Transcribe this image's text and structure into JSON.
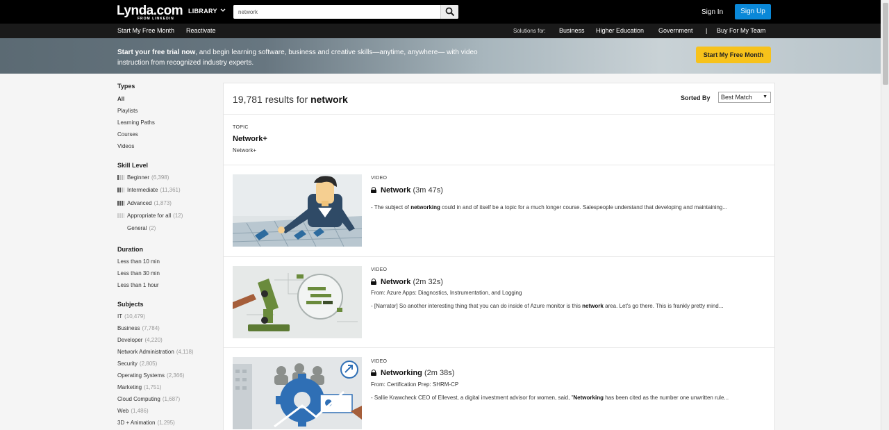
{
  "header": {
    "logo": "Lynda.com",
    "logo_sub": "FROM LINKEDIN",
    "library_label": "LIBRARY",
    "search_value": "network",
    "signin_label": "Sign In",
    "signup_label": "Sign Up"
  },
  "subnav": {
    "left": [
      "Start My Free Month",
      "Reactivate"
    ],
    "solutions_label": "Solutions for:",
    "right": [
      "Business",
      "Higher Education",
      "Government",
      "|",
      "Buy For My Team"
    ]
  },
  "banner": {
    "bold": "Start your free trial now",
    "text": ", and begin learning software, business and creative skills—anytime, anywhere— with video instruction from recognized industry experts.",
    "cta": "Start My Free Month"
  },
  "sidebar": {
    "types": {
      "heading": "Types",
      "items": [
        "All",
        "Playlists",
        "Learning Paths",
        "Courses",
        "Videos"
      ]
    },
    "skill": {
      "heading": "Skill Level",
      "items": [
        {
          "label": "Beginner",
          "count": "(6,398)"
        },
        {
          "label": "Intermediate",
          "count": "(11,361)"
        },
        {
          "label": "Advanced",
          "count": "(1,873)"
        },
        {
          "label": "Appropriate for all",
          "count": "(12)"
        },
        {
          "label": "General",
          "count": "(2)"
        }
      ]
    },
    "duration": {
      "heading": "Duration",
      "items": [
        "Less than 10 min",
        "Less than 30 min",
        "Less than 1 hour"
      ]
    },
    "subjects": {
      "heading": "Subjects",
      "items": [
        {
          "label": "IT",
          "count": "(10,479)"
        },
        {
          "label": "Business",
          "count": "(7,784)"
        },
        {
          "label": "Developer",
          "count": "(4,220)"
        },
        {
          "label": "Network Administration",
          "count": "(4,118)"
        },
        {
          "label": "Security",
          "count": "(2,805)"
        },
        {
          "label": "Operating Systems",
          "count": "(2,366)"
        },
        {
          "label": "Marketing",
          "count": "(1,751)"
        },
        {
          "label": "Cloud Computing",
          "count": "(1,687)"
        },
        {
          "label": "Web",
          "count": "(1,486)"
        },
        {
          "label": "3D + Animation",
          "count": "(1,295)"
        }
      ]
    }
  },
  "results": {
    "count": "19,781",
    "text": "results for",
    "query": "network",
    "sorted_label": "Sorted By",
    "sort_value": "Best Match",
    "topic": {
      "label": "TOPIC",
      "title": "Network+",
      "sub": "Network+"
    },
    "videos": [
      {
        "label": "VIDEO",
        "title": "Network",
        "duration": "(3m 47s)",
        "from": "",
        "desc_pre": "- The subject of ",
        "desc_bold": "networking",
        "desc_post": " could in and of itself be a topic for a much longer course. Salespeople understand that developing and maintaining..."
      },
      {
        "label": "VIDEO",
        "title": "Network",
        "duration": "(2m 32s)",
        "from": "From: Azure Apps: Diagnostics, Instrumentation, and Logging",
        "desc_pre": "- [Narrator] So another interesting thing that you can do inside of Azure monitor is this ",
        "desc_bold": "network",
        "desc_post": " area. Let's go there. This is frankly pretty mind..."
      },
      {
        "label": "VIDEO",
        "title": "Networking",
        "duration": "(2m 38s)",
        "from": "From: Certification Prep: SHRM-CP",
        "desc_pre": "- Sallie Krawcheck CEO of Ellevest, a digital investment advisor for women, said, \"",
        "desc_bold": "Networking",
        "desc_post": " has been cited as the number one unwritten rule..."
      }
    ]
  },
  "colors": {
    "accent_blue": "#0a88d8",
    "cta_yellow": "#f7c21b",
    "header_bg": "#000000"
  }
}
